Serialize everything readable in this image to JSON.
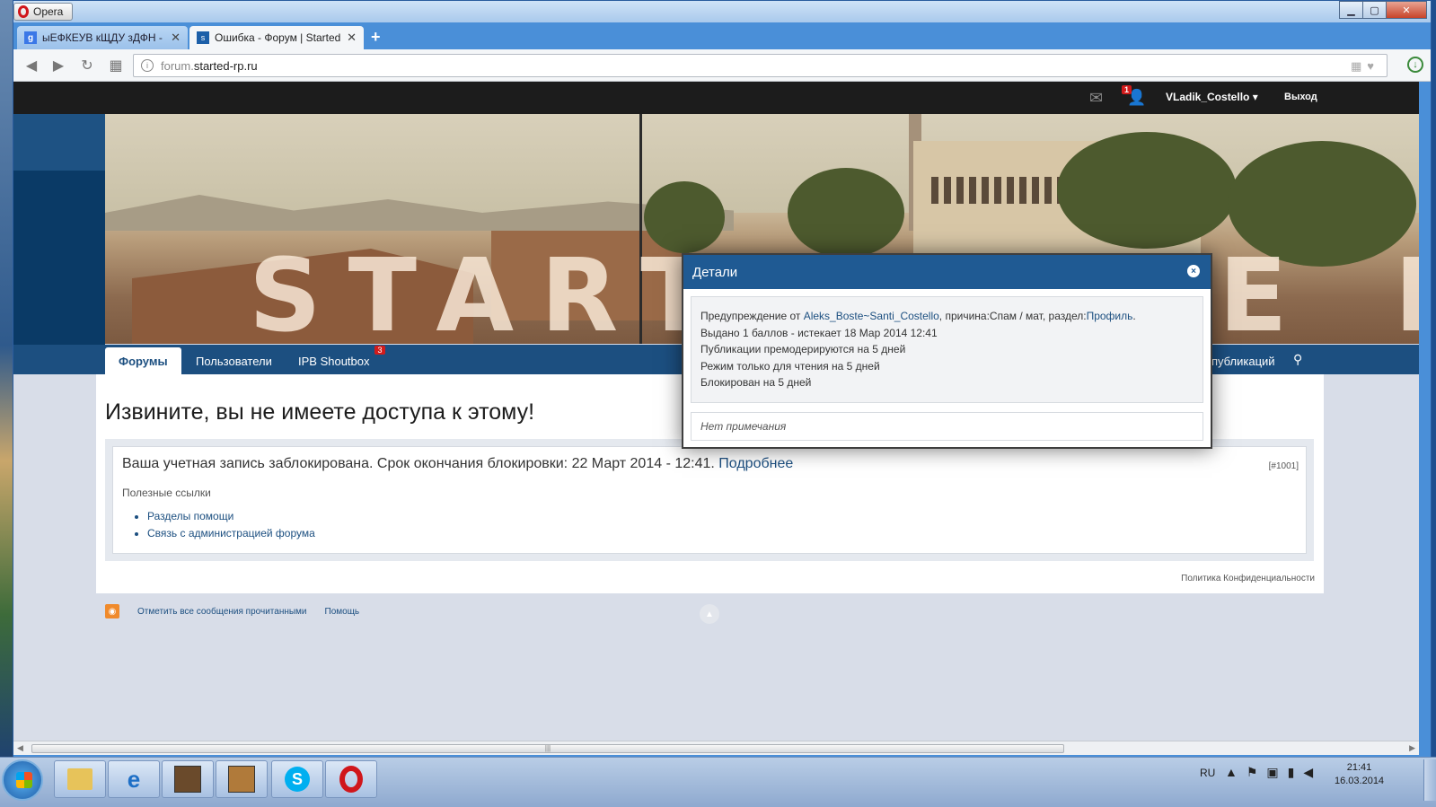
{
  "browser": {
    "menu_label": "Opera",
    "tabs": [
      {
        "favicon": "g",
        "title": "ыЕФКЕУВ кЩДУ зДФН - Google"
      },
      {
        "favicon": "s",
        "title": "Ошибка - Форум | Started RP"
      }
    ],
    "new_tab": "+",
    "url_scheme": "forum.",
    "url_host": "started-rp.ru",
    "winbtn_min": "▁",
    "winbtn_max": "▢",
    "winbtn_close": "✕"
  },
  "topbar": {
    "notif_count": "1",
    "username": "VLadik_Costello ▾",
    "logout": "Выход"
  },
  "banner": {
    "text_left": "START",
    "text_right": "E P"
  },
  "nav": {
    "tabs": [
      {
        "label": "Форумы",
        "active": true
      },
      {
        "label": "Пользователи"
      },
      {
        "label": "IPB Shoutbox",
        "badge": "3"
      }
    ],
    "right_label": "публикаций"
  },
  "page": {
    "title": "Извините, вы не имеете доступа к этому!",
    "message_prefix": "Ваша учетная запись заблокирована. Срок окончания блокировки: 22 Март 2014 - 12:41.",
    "message_link": "Подробнее",
    "error_code": "[#1001]",
    "useful_links_title": "Полезные ссылки",
    "useful_links": [
      "Разделы помощи",
      "Связь с администрацией форума"
    ],
    "policy": "Политика Конфиденциальности"
  },
  "footer": {
    "mark_read": "Отметить все сообщения прочитанными",
    "help": "Помощь"
  },
  "modal": {
    "title": "Детали",
    "warn_prefix": "Предупреждение от ",
    "warn_from": "Aleks_Boste~Santi_Costello",
    "warn_reason": ", причина:Спам / мат, раздел:",
    "warn_section": "Профиль",
    "warn_dot": ".",
    "line2": "Выдано 1 баллов - истекает 18 Мар 2014 12:41",
    "line3": "Публикации премодерируются на 5 дней",
    "line4": "Режим только для чтения на 5 дней",
    "line5": "Блокирован на 5 дней",
    "note": "Нет примечания"
  },
  "taskbar": {
    "lang": "RU",
    "time": "21:41",
    "date": "16.03.2014"
  },
  "icons": {
    "back": "back-arrow-icon",
    "forward": "forward-arrow-icon",
    "reload": "reload-icon",
    "speed_dial": "grid-icon",
    "mail": "envelope-icon",
    "notifications": "notification-icon",
    "location": "pin-icon",
    "rss": "rss-icon"
  },
  "colors": {
    "forum_blue": "#1c4f80",
    "modal_header": "#1f5a93",
    "badge_red": "#d21b1b"
  }
}
